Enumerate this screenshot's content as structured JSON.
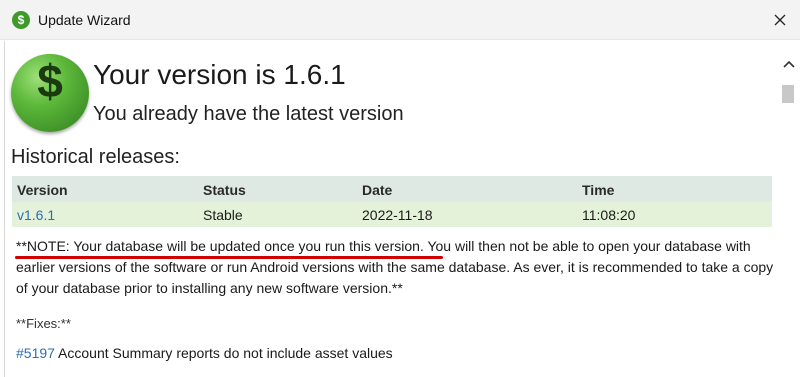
{
  "window": {
    "title": "Update Wizard",
    "icon": "dollar-icon",
    "close_icon": "close-icon"
  },
  "header": {
    "logo_symbol": "$",
    "version_title": "Your version is 1.6.1",
    "status_text": "You already have the latest version"
  },
  "releases": {
    "heading": "Historical releases:",
    "columns": [
      "Version",
      "Status",
      "Date",
      "Time"
    ],
    "rows": [
      {
        "version": "v1.6.1",
        "status": "Stable",
        "date": "2022-11-18",
        "time": "11:08:20"
      }
    ]
  },
  "notes": {
    "note_highlight": "**NOTE: Your database will be updated once you run this version.",
    "note_rest": " You will then not be able to open your database with earlier versions of the software or run Android versions with the same database. As ever, it is recommended to take a copy of your database prior to installing any new software version.**",
    "fixes_label": "**Fixes:**",
    "fix_link": "#5197",
    "fix_text": " Account Summary reports do not include asset values"
  },
  "colors": {
    "accent_green": "#3f9a2c",
    "link_blue": "#2e6db5",
    "annotation_red": "#d10000",
    "row_green": "#e4f2d9",
    "header_bg": "#dfe9e3"
  }
}
